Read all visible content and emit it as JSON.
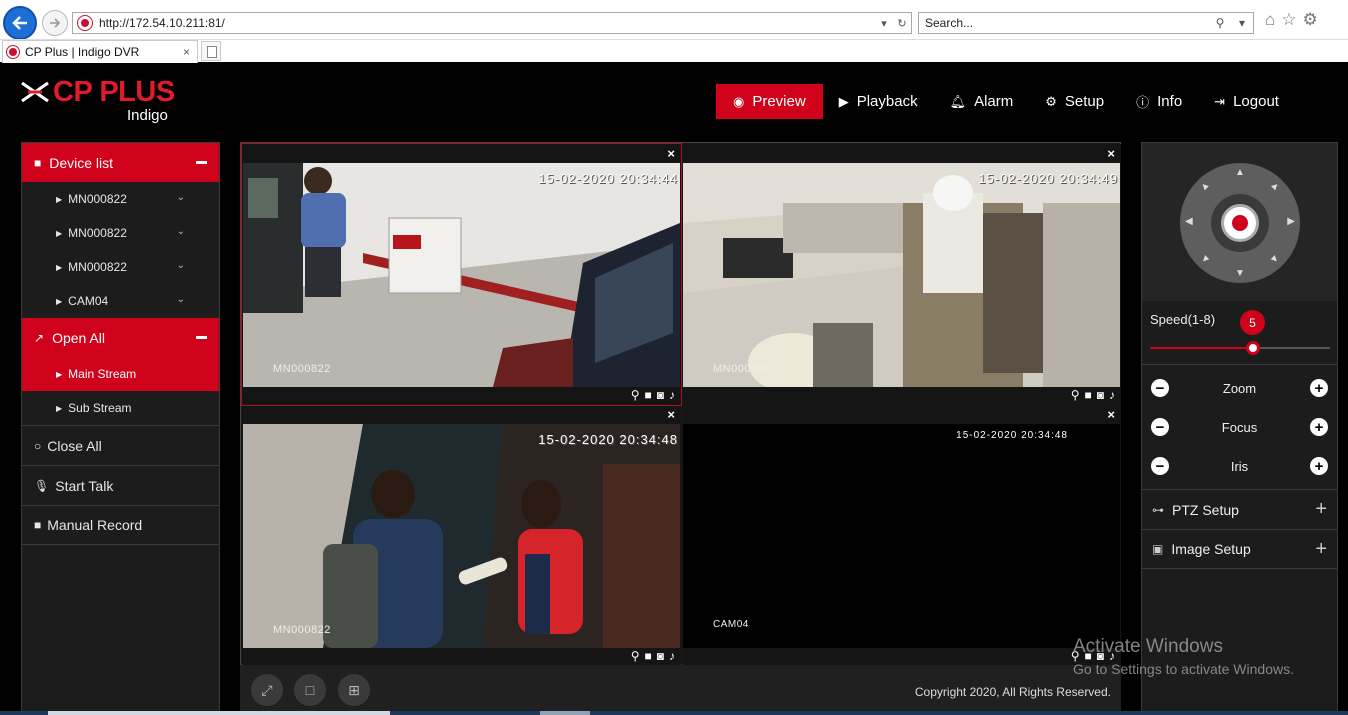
{
  "browser": {
    "url": "http://172.54.10.211:81/",
    "search_placeholder": "Search...",
    "tab_title": "CP Plus | Indigo DVR",
    "tab_close": "×"
  },
  "brand": {
    "name": "CP PLUS",
    "sub": "Indigo",
    "accent": "#d0021b"
  },
  "topnav": [
    {
      "label": "Preview",
      "icon": "eye-icon",
      "active": true
    },
    {
      "label": "Playback",
      "icon": "play-circle-icon"
    },
    {
      "label": "Alarm",
      "icon": "bell-icon"
    },
    {
      "label": "Setup",
      "icon": "gear-icon"
    },
    {
      "label": "Info",
      "icon": "info-icon"
    },
    {
      "label": "Logout",
      "icon": "logout-icon"
    }
  ],
  "sidebar": {
    "device_list_label": "Device list",
    "devices": [
      {
        "label": "MN000822"
      },
      {
        "label": "MN000822"
      },
      {
        "label": "MN000822"
      },
      {
        "label": "CAM04"
      }
    ],
    "open_all_label": "Open All",
    "streams": [
      {
        "label": "Main Stream",
        "active": true
      },
      {
        "label": "Sub Stream"
      }
    ],
    "actions": [
      {
        "label": "Close All",
        "icon": "circle-icon"
      },
      {
        "label": "Start Talk",
        "icon": "microphone-icon"
      },
      {
        "label": "Manual Record",
        "icon": "video-camera-icon"
      }
    ]
  },
  "cameras": [
    {
      "timestamp": "15-02-2020 20:34:44",
      "name": "MN000822",
      "selected": true
    },
    {
      "timestamp": "15-02-2020 20:34:49",
      "name": "MN000822"
    },
    {
      "timestamp": "15-02-2020 20:34:48",
      "name": "MN000822"
    },
    {
      "timestamp": "15-02-2020 20:34:48",
      "name": "CAM04"
    }
  ],
  "close_glyph": "×",
  "footer": {
    "copyright": "Copyright 2020, All Rights Reserved."
  },
  "ptz": {
    "speed_label": "Speed(1-8)",
    "speed_value": "5",
    "speed_min": 1,
    "speed_max": 8,
    "controls": [
      {
        "label": "Zoom"
      },
      {
        "label": "Focus"
      },
      {
        "label": "Iris"
      }
    ],
    "ptz_setup_label": "PTZ Setup",
    "image_setup_label": "Image Setup"
  },
  "watermark": {
    "line1": "Activate Windows",
    "line2": "Go to Settings to activate Windows."
  }
}
